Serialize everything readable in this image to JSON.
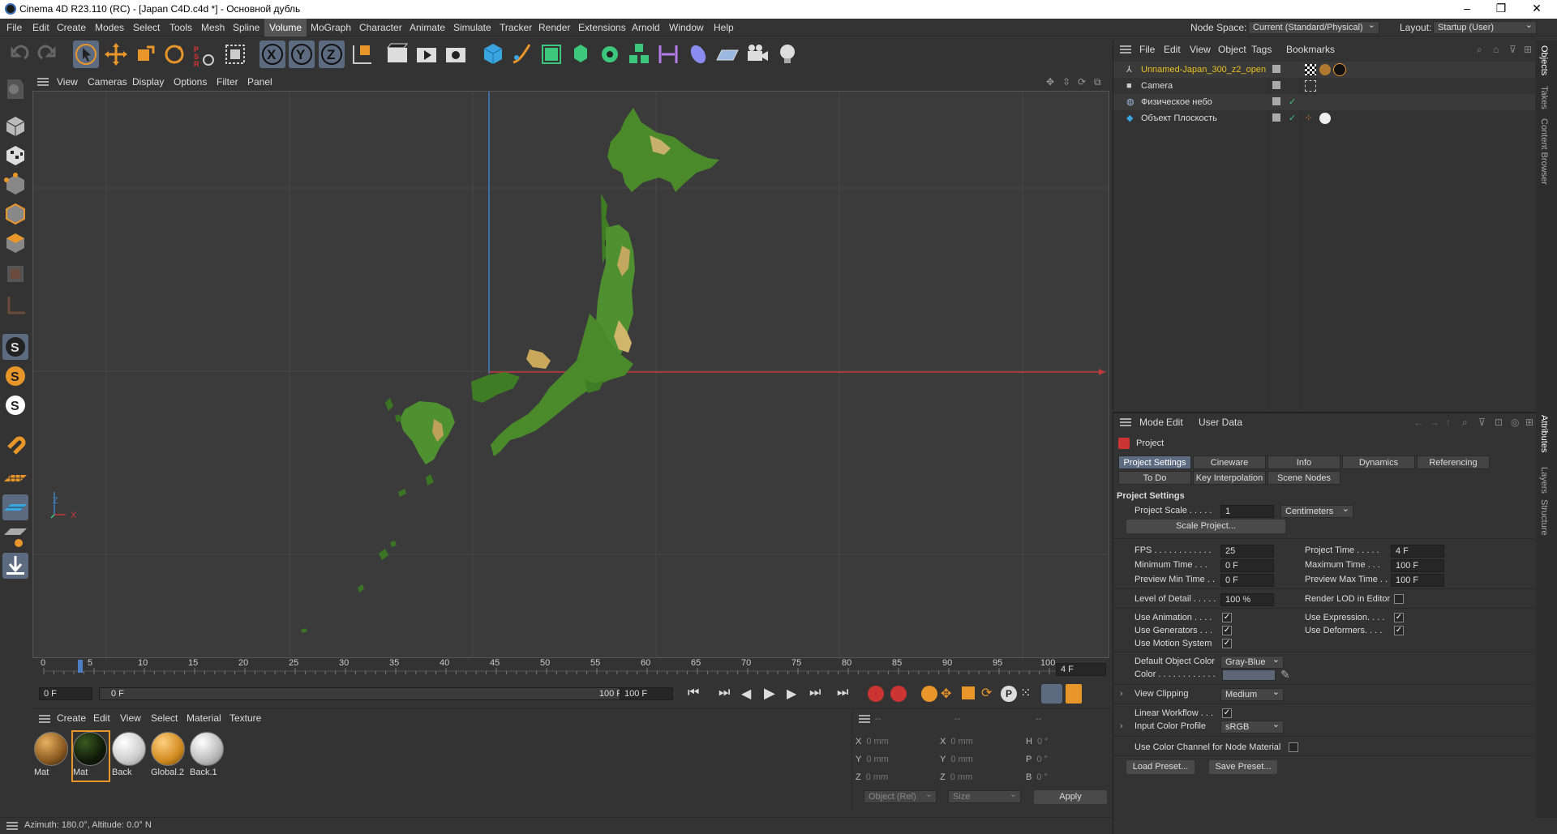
{
  "window": {
    "title": "Cinema 4D R23.110 (RC) - [Japan C4D.c4d *] - Основной дубль",
    "minimize": "–",
    "restore": "❐",
    "close": "✕"
  },
  "menubar": {
    "items": [
      "File",
      "Edit",
      "Create",
      "Modes",
      "Select",
      "Tools",
      "Mesh",
      "Spline",
      "Volume",
      "MoGraph",
      "Character",
      "Animate",
      "Simulate",
      "Tracker",
      "Render",
      "Extensions",
      "Arnold",
      "Window",
      "Help"
    ],
    "active": "Volume",
    "node_space_label": "Node Space:",
    "node_space_value": "Current (Standard/Physical)",
    "layout_label": "Layout:",
    "layout_value": "Startup (User)"
  },
  "toolbar": {
    "axis_x": "X",
    "axis_y": "Y",
    "axis_z": "Z",
    "psr": "PSR"
  },
  "viewport_menu": [
    "View",
    "Cameras",
    "Display",
    "Options",
    "Filter",
    "Panel"
  ],
  "viewport": {
    "axis_x_label": "X",
    "axis_z_label": "Z"
  },
  "timeline": {
    "ticks": [
      "0",
      "5",
      "10",
      "15",
      "20",
      "25",
      "30",
      "35",
      "40",
      "45",
      "50",
      "55",
      "60",
      "65",
      "70",
      "75",
      "80",
      "85",
      "90",
      "95",
      "100"
    ],
    "current_frame": "4 F"
  },
  "transport": {
    "start": "0 F",
    "range_start": "0 F",
    "range_end": "100 F",
    "end": "100 F"
  },
  "materials": {
    "menu": [
      "Create",
      "Edit",
      "View",
      "Select",
      "Material",
      "Texture"
    ],
    "items": [
      {
        "name": "Mat",
        "color": "#b07830"
      },
      {
        "name": "Mat",
        "color": "#1a2a12"
      },
      {
        "name": "Back",
        "color": "#e8e8e8"
      },
      {
        "name": "Global.2",
        "color": "#e0a040"
      },
      {
        "name": "Back.1",
        "color": "#d8d8d8"
      }
    ]
  },
  "coords": {
    "headers": [
      "--",
      "--",
      "--"
    ],
    "rows": [
      {
        "a": "X",
        "av": "0 mm",
        "b": "X",
        "bv": "0 mm",
        "c": "H",
        "cv": "0 °"
      },
      {
        "a": "Y",
        "av": "0 mm",
        "b": "Y",
        "bv": "0 mm",
        "c": "P",
        "cv": "0 °"
      },
      {
        "a": "Z",
        "av": "0 mm",
        "b": "Z",
        "bv": "0 mm",
        "c": "B",
        "cv": "0 °"
      }
    ],
    "mode": "Object (Rel)",
    "size_mode": "Size",
    "apply": "Apply"
  },
  "status": {
    "text": "Azimuth: 180.0°, Altitude: 0.0°  N"
  },
  "objects": {
    "menu": [
      "File",
      "Edit",
      "View",
      "Object",
      "Tags",
      "Bookmarks"
    ],
    "rows": [
      {
        "name": "Unnamed-Japan_300_z2_open",
        "highlight": true
      },
      {
        "name": "Camera",
        "highlight": false
      },
      {
        "name": "Физическое небо",
        "highlight": false
      },
      {
        "name": "Объект Плоскость",
        "highlight": false
      }
    ]
  },
  "right_tabs": {
    "top": [
      "Objects",
      "Takes",
      "Content Browser"
    ],
    "bottom": [
      "Attributes",
      "Layers",
      "Structure"
    ]
  },
  "attributes": {
    "menu": [
      "Mode",
      "Edit",
      "User Data"
    ],
    "object": "Project",
    "tabs_row1": [
      "Project Settings",
      "Cineware",
      "Info",
      "Dynamics",
      "Referencing"
    ],
    "tabs_row2": [
      "To Do",
      "Key Interpolation",
      "Scene Nodes"
    ],
    "section": "Project Settings",
    "project_scale_label": "Project Scale . . . . .",
    "project_scale_value": "1",
    "project_scale_unit": "Centimeters",
    "scale_button": "Scale Project...",
    "fps_label": "FPS . . . . . . . . . . . .",
    "fps_value": "25",
    "project_time_label": "Project Time . . . . .",
    "project_time_value": "4 F",
    "min_time_label": "Minimum Time . . .",
    "min_time_value": "0 F",
    "max_time_label": "Maximum Time . . .",
    "max_time_value": "100 F",
    "prev_min_label": "Preview Min Time . .",
    "prev_min_value": "0 F",
    "prev_max_label": "Preview Max Time . .",
    "prev_max_value": "100 F",
    "lod_label": "Level of Detail . . . . .",
    "lod_value": "100 %",
    "render_lod_label": "Render LOD in Editor",
    "use_animation_label": "Use Animation . . . .",
    "use_expression_label": "Use Expression. . . .",
    "use_generators_label": "Use Generators . . .",
    "use_deformers_label": "Use Deformers. . . .",
    "use_motion_label": "Use Motion System",
    "default_color_label": "Default Object Color",
    "default_color_value": "Gray-Blue",
    "color_label": "Color . . . . . . . . . . . .",
    "view_clipping_label": "View Clipping",
    "view_clipping_value": "Medium",
    "linear_workflow_label": "Linear Workflow . . .",
    "input_profile_label": "Input Color Profile",
    "input_profile_value": "sRGB",
    "color_channel_label": "Use Color Channel for Node Material",
    "load_preset": "Load Preset...",
    "save_preset": "Save Preset...",
    "check": "✓"
  }
}
